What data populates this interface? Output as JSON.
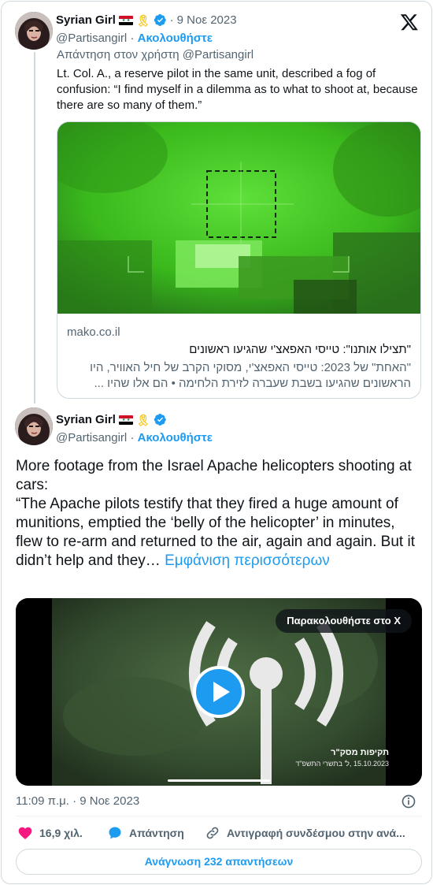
{
  "brand_color": "#1d9bf0",
  "quoted_tweet": {
    "author_name": "Syrian Girl",
    "emoji": [
      "syria-flag",
      "yellow-ribbon",
      "verified-badge"
    ],
    "date": "9 Νοε 2023",
    "handle": "@Partisangirl",
    "follow_label": "Ακολουθήστε",
    "replying_to": "Απάντηση στον χρήστη @Partisangirl",
    "text": "Lt. Col. A., a reserve pilot in the same unit, described a fog of confusion: “I find myself in a dilemma as to what to shoot at, because there are so many of them.”",
    "link_card": {
      "domain": "mako.co.il",
      "title": "\"תצילו אותנו\": טייסי האפאצ'י שהגיעו ראשונים",
      "description": "\"האחת\" של 2023: טייסי האפאצ'י, מסוקי הקרב של חיל האוויר, היו הראשונים שהגיעו בשבת שעברה לזירת הלחימה • הם אלו שהיו ..."
    }
  },
  "main_tweet": {
    "author_name": "Syrian Girl",
    "handle": "@Partisangirl",
    "follow_label": "Ακολουθήστε",
    "text": "More footage from the Israel Apache helicopters shooting at cars:\n“The Apache pilots testify that they fired a huge amount of munitions, emptied the ‘belly of the helicopter’ in minutes, flew to re-arm and returned to the air, again and again. But it didn’t help and they…",
    "show_more": "Εμφάνιση περισσότερων",
    "video": {
      "watch_label": "Παρακολουθήστε στο X",
      "caption_line1": "תקיפות מסק\"ר",
      "caption_line2": "15.10.2023 ,ל' בתשרי התשפ\"ד"
    },
    "timestamp": "11:09 π.μ. · 9 Νοε 2023",
    "likes": "16,9 χιλ.",
    "reply_label": "Απάντηση",
    "copy_link_label": "Αντιγραφή συνδέσμου στην ανά...",
    "read_replies_label": "Ανάγνωση 232 απαντήσεων"
  }
}
